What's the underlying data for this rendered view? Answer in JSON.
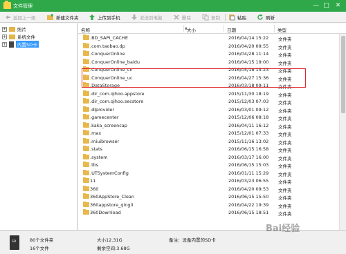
{
  "window": {
    "title": "文件管理"
  },
  "titlebar_buttons": {
    "minimize": "—",
    "maximize": "□",
    "close": "✕"
  },
  "toolbar": {
    "back": "返回上一级",
    "new_folder": "新建文件夹",
    "upload": "上传到手机",
    "send_pc": "发送到电脑",
    "delete": "删除",
    "copy": "复制",
    "paste": "粘贴",
    "refresh": "刷新"
  },
  "tree": {
    "items": [
      {
        "label": "照片",
        "expander": "+"
      },
      {
        "label": "系统文件",
        "expander": "+"
      },
      {
        "label": "内置SD卡",
        "expander": "+",
        "selected": true
      }
    ]
  },
  "columns": {
    "name": "名称",
    "size": "大小",
    "date": "日期",
    "type": "类型"
  },
  "files": [
    {
      "name": ".BD_SAPI_CACHE",
      "date": "2016/04/14 15:22",
      "type": "文件夹"
    },
    {
      "name": ".com.taobao.dp",
      "date": "2016/04/20 09:55",
      "type": "文件夹"
    },
    {
      "name": ".ConquerOnline",
      "date": "2016/04/28 11:14",
      "type": "文件夹"
    },
    {
      "name": ".ConquerOnline_baidu",
      "date": "2016/04/15 19:00",
      "type": "文件夹"
    },
    {
      "name": ".ConquerOnline_cn",
      "date": "2016/05/18 15:23",
      "type": "文件夹"
    },
    {
      "name": ".ConquerOnline_uc",
      "date": "2016/04/27 15:36",
      "type": "文件夹"
    },
    {
      "name": ".DataStorage",
      "date": "2016/03/18 09:11",
      "type": "文件夹"
    },
    {
      "name": ".dir_com.qihoo.appstore",
      "date": "2015/11/30 18:19",
      "type": "文件夹"
    },
    {
      "name": ".dir_com.qihoo.secstore",
      "date": "2015/12/03 07:03",
      "type": "文件夹"
    },
    {
      "name": ".dlprovider",
      "date": "2016/03/01 09:12",
      "type": "文件夹"
    },
    {
      "name": ".gamecenter",
      "date": "2015/12/06 08:18",
      "type": "文件夹"
    },
    {
      "name": ".kaka_screencap",
      "date": "2016/04/11 16:12",
      "type": "文件夹"
    },
    {
      "name": ".max",
      "date": "2015/12/01 07:33",
      "type": "文件夹"
    },
    {
      "name": ".miuibrowser",
      "date": "2015/11/16 13:02",
      "type": "文件夹"
    },
    {
      "name": ".stats",
      "date": "2016/06/15 16:58",
      "type": "文件夹"
    },
    {
      "name": ".system",
      "date": "2016/03/17 16:00",
      "type": "文件夹"
    },
    {
      "name": ".tbs",
      "date": "2016/06/15 15:03",
      "type": "文件夹"
    },
    {
      "name": ".UTSystemConfig",
      "date": "2016/01/11 15:29",
      "type": "文件夹"
    },
    {
      "name": "11",
      "date": "2016/03/23 06:55",
      "type": "文件夹"
    },
    {
      "name": "360",
      "date": "2016/04/20 09:53",
      "type": "文件夹"
    },
    {
      "name": "360AppStore_Clean",
      "date": "2016/06/15 15:50",
      "type": "文件夹"
    },
    {
      "name": "360appstore_qingli",
      "date": "2016/04/22 19:39",
      "type": "文件夹"
    },
    {
      "name": "360Download",
      "date": "2016/06/15 18:51",
      "type": "文件夹"
    }
  ],
  "status": {
    "folders": "80个文件夹",
    "files": "16个文件",
    "size": "大小12.31G",
    "free": "剩余空间:3.68G",
    "note": "备注：设备内置的SD卡"
  },
  "watermark": "Bai经验",
  "colors": {
    "titlebar": "#2fa849",
    "highlight": "#e0282e",
    "selected": "#3399ff"
  }
}
